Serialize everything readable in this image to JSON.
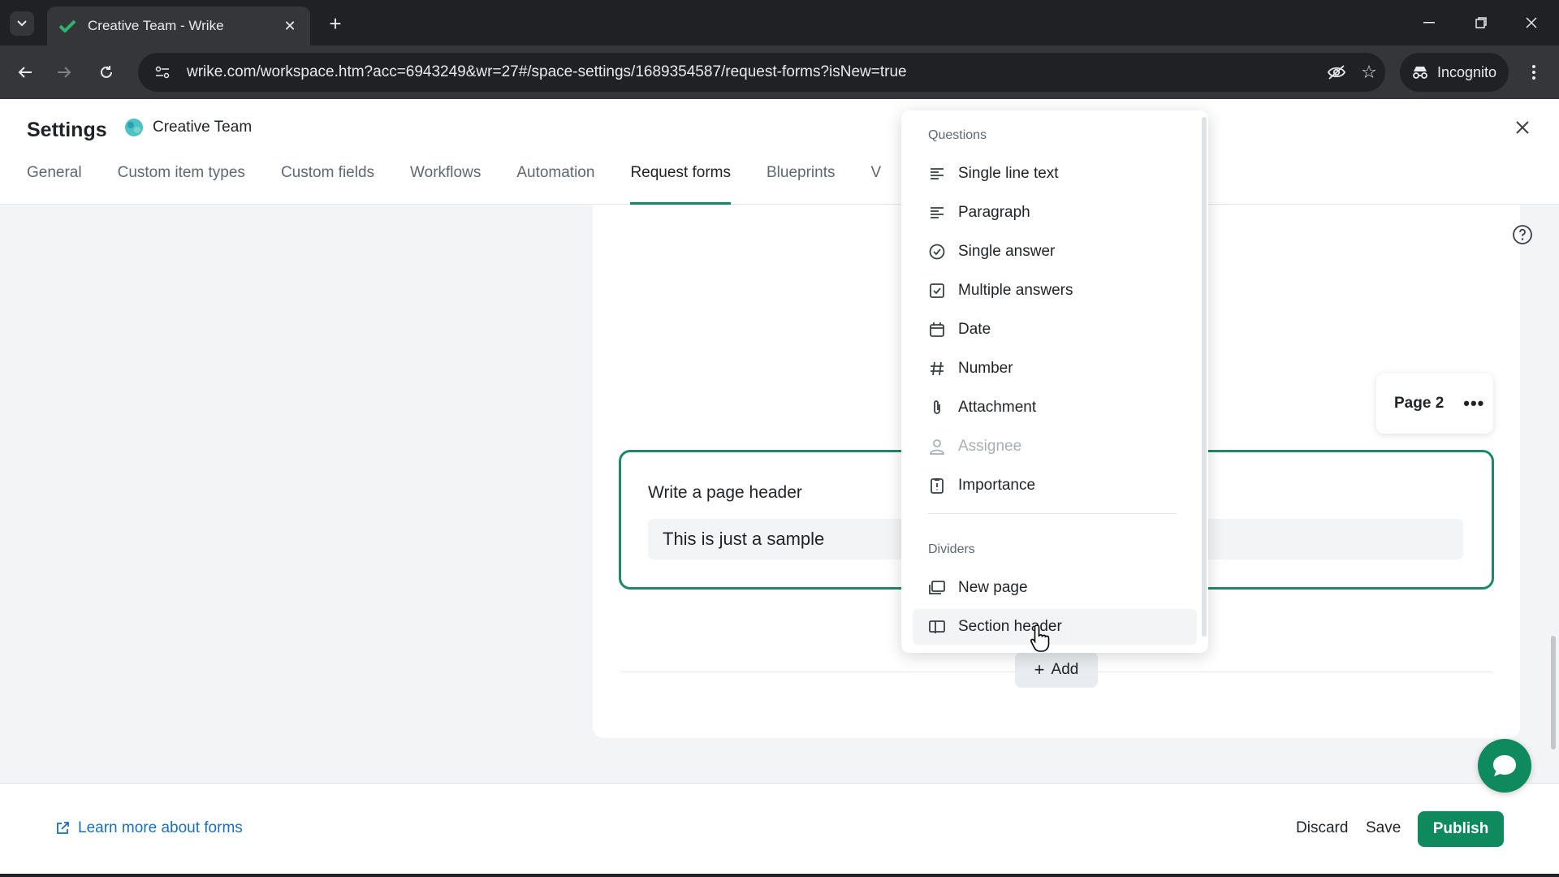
{
  "browser": {
    "tab_title": "Creative Team - Wrike",
    "url": "wrike.com/workspace.htm?acc=6943249&wr=27#/space-settings/1689354587/request-forms?isNew=true",
    "incognito_label": "Incognito"
  },
  "header": {
    "title": "Settings",
    "space_name": "Creative Team",
    "tabs": [
      {
        "label": "General"
      },
      {
        "label": "Custom item types"
      },
      {
        "label": "Custom fields"
      },
      {
        "label": "Workflows"
      },
      {
        "label": "Automation"
      },
      {
        "label": "Request forms"
      },
      {
        "label": "Blueprints"
      },
      {
        "label": "V"
      }
    ]
  },
  "form": {
    "page_label": "Page 2",
    "section_title": "Write a page header",
    "section_value": "This is just a sample",
    "add_label": "Add"
  },
  "menu": {
    "questions_label": "Questions",
    "questions": [
      {
        "label": "Single line text",
        "icon": "single-line-text-icon"
      },
      {
        "label": "Paragraph",
        "icon": "paragraph-icon"
      },
      {
        "label": "Single answer",
        "icon": "single-answer-icon"
      },
      {
        "label": "Multiple answers",
        "icon": "multiple-answers-icon"
      },
      {
        "label": "Date",
        "icon": "calendar-icon"
      },
      {
        "label": "Number",
        "icon": "hash-icon"
      },
      {
        "label": "Attachment",
        "icon": "paperclip-icon"
      },
      {
        "label": "Assignee",
        "icon": "person-icon",
        "disabled": true
      },
      {
        "label": "Importance",
        "icon": "importance-icon"
      }
    ],
    "dividers_label": "Dividers",
    "dividers": [
      {
        "label": "New page",
        "icon": "new-page-icon"
      },
      {
        "label": "Section header",
        "icon": "section-header-icon",
        "hovered": true
      }
    ]
  },
  "footer": {
    "learn_more": "Learn more about forms",
    "discard": "Discard",
    "save": "Save",
    "publish": "Publish"
  },
  "colors": {
    "accent": "#0f8a5f",
    "link": "#1b6fb8",
    "section_border": "#1e8a63"
  }
}
